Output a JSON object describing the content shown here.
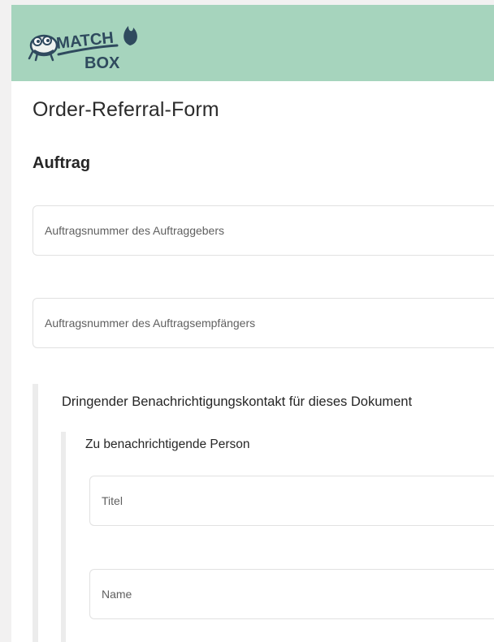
{
  "header": {
    "logo_text_top": "MATCH",
    "logo_text_bottom": "BOX",
    "background_color": "#a6d4bd",
    "logo_color": "#2f4a5e"
  },
  "form": {
    "title": "Order-Referral-Form",
    "section": {
      "title": "Auftrag",
      "fields": [
        {
          "placeholder": "Auftragsnummer des Auftraggebers",
          "value": ""
        },
        {
          "placeholder": "Auftragsnummer des Auftragsempfängers",
          "value": ""
        }
      ]
    },
    "urgent_contact": {
      "label": "Dringender Benachrichtigungskontakt für dieses Dokument",
      "person": {
        "label": "Zu benachrichtigende Person",
        "fields": [
          {
            "placeholder": "Titel",
            "value": ""
          },
          {
            "placeholder": "Name",
            "value": ""
          }
        ]
      }
    }
  }
}
